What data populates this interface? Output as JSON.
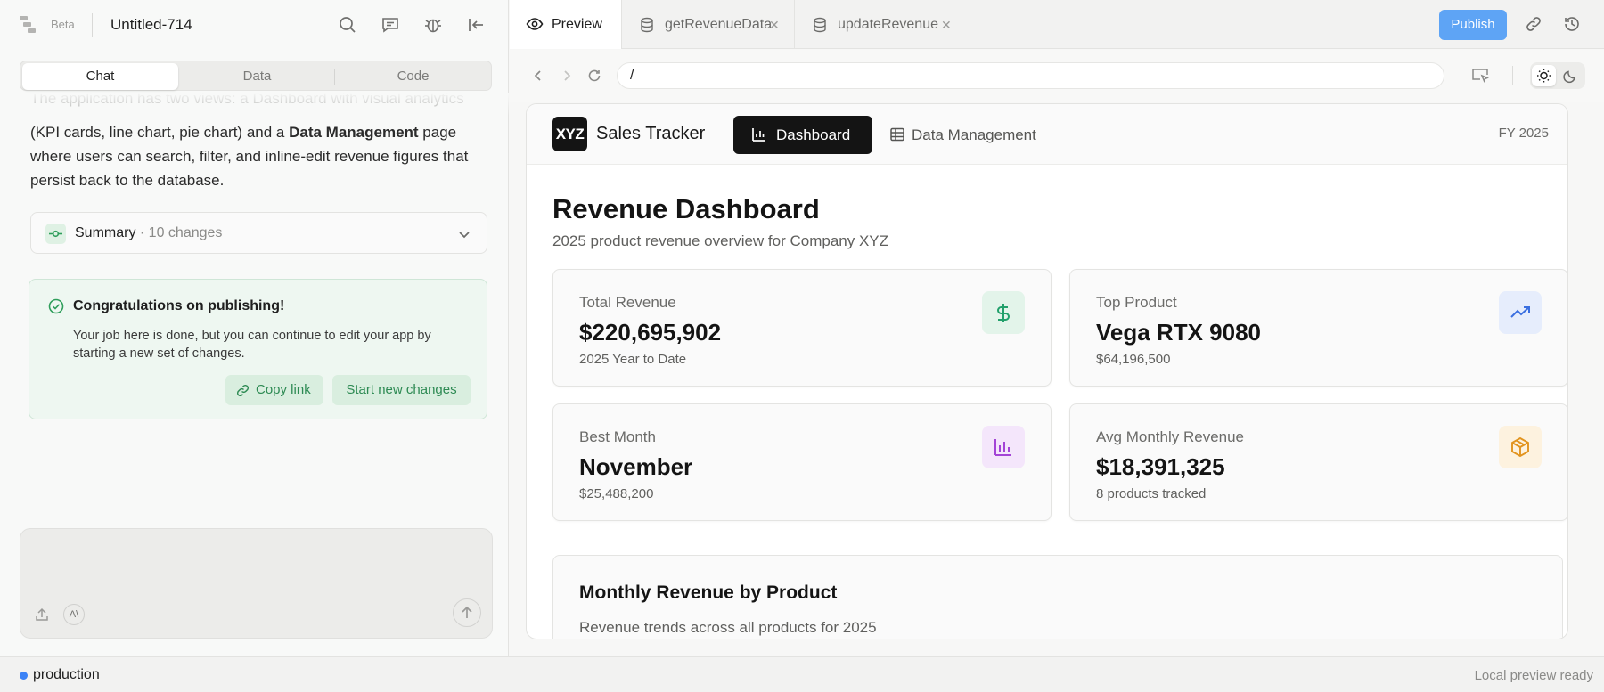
{
  "app": {
    "beta": "Beta",
    "doc_title": "Untitled-714"
  },
  "tabs_left": [
    "Chat",
    "Data",
    "Code"
  ],
  "chat": {
    "faded_line": "The application has two views: a Dashboard with visual analytics",
    "line2": "(KPI cards, line chart, pie chart) and a ",
    "line2_bold": "Data Management",
    "line2_end": " page",
    "line3": "where users can search, filter, and inline-edit revenue figures that",
    "line4": "persist back to the database."
  },
  "summary": {
    "label": "Summary",
    "count": " · 10 changes"
  },
  "congrats": {
    "title": "Congratulations on publishing!",
    "body": "Your job here is done, but you can continue to edit your app by starting a new set of changes.",
    "copy_link": "Copy link",
    "start_new": "Start new changes"
  },
  "editor_tabs": [
    {
      "label": "Preview"
    },
    {
      "label": "getRevenueData"
    },
    {
      "label": "updateRevenue"
    }
  ],
  "publish": "Publish",
  "url": "/",
  "site": {
    "logo": "XYZ",
    "name": "Sales Tracker",
    "nav_dashboard": "Dashboard",
    "nav_data": "Data Management",
    "fy": "FY 2025",
    "title": "Revenue Dashboard",
    "subtitle": "2025 product revenue overview for Company XYZ",
    "kpis": [
      {
        "label": "Total Revenue",
        "value": "$220,695,902",
        "sub": "2025 Year to Date",
        "icon": "dollar-icon",
        "color": "#22a06b"
      },
      {
        "label": "Top Product",
        "value": "Vega RTX 9080",
        "sub": "$64,196,500",
        "icon": "trending-up-icon",
        "color": "#3b6fe0"
      },
      {
        "label": "Best Month",
        "value": "November",
        "sub": "$25,488,200",
        "icon": "bar-chart-icon",
        "color": "#a345d6"
      },
      {
        "label": "Avg Monthly Revenue",
        "value": "$18,391,325",
        "sub": "8 products tracked",
        "icon": "package-icon",
        "color": "#e2941f"
      }
    ],
    "chart_title": "Monthly Revenue by Product",
    "chart_sub": "Revenue trends across all products for 2025"
  },
  "statusbar": {
    "env": "production",
    "status": "Local preview ready"
  }
}
